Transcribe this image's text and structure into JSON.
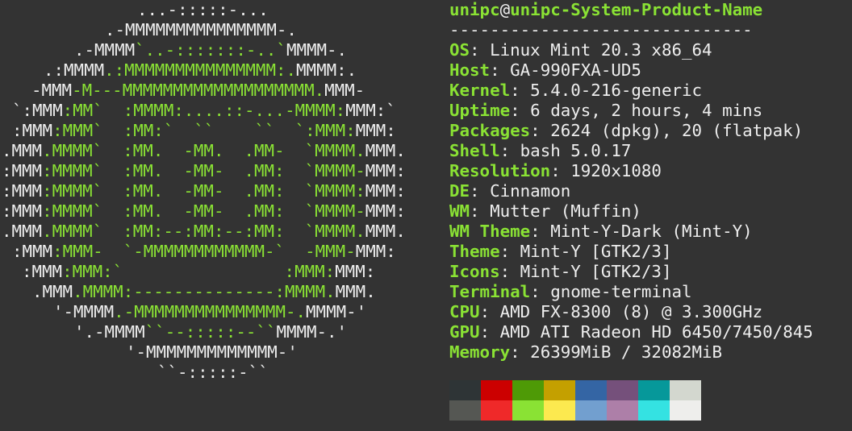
{
  "logo": {
    "lines": [
      [
        {
          "t": "...-:::::-...",
          "c": "w"
        }
      ],
      [
        {
          "t": ".-MMMMMMMMMMMMMMM-.",
          "c": "w"
        }
      ],
      [
        {
          "t": ".-MMMM",
          "c": "w"
        },
        {
          "t": "`..-:::::::-..`",
          "c": "g"
        },
        {
          "t": "MMMM-.",
          "c": "w"
        }
      ],
      [
        {
          "t": ".:MMMM",
          "c": "w"
        },
        {
          "t": ".:MMMMMMMMMMMMMMM:.",
          "c": "g"
        },
        {
          "t": "MMMM:.",
          "c": "w"
        }
      ],
      [
        {
          "t": "-MMM",
          "c": "w"
        },
        {
          "t": "-M---MMMMMMMMMMMMMMMMMMM.",
          "c": "g"
        },
        {
          "t": "MMM-",
          "c": "w"
        }
      ],
      [
        {
          "t": "`:MMM",
          "c": "w"
        },
        {
          "t": ":MM`  :MMMM:....::-...-MMMM:",
          "c": "g"
        },
        {
          "t": "MMM:`",
          "c": "w"
        }
      ],
      [
        {
          "t": ":MMM",
          "c": "w"
        },
        {
          "t": ":MMM`  :MM:`  ``    ``  `:MMM:",
          "c": "g"
        },
        {
          "t": "MMM:",
          "c": "w"
        }
      ],
      [
        {
          "t": ".MMM",
          "c": "w"
        },
        {
          "t": ".MMMM`  :MM.  -MM.  .MM-  `MMMM.",
          "c": "g"
        },
        {
          "t": "MMM.",
          "c": "w"
        }
      ],
      [
        {
          "t": ":MMM",
          "c": "w"
        },
        {
          "t": ":MMMM`  :MM.  -MM-  .MM:  `MMMM-",
          "c": "g"
        },
        {
          "t": "MMM:",
          "c": "w"
        }
      ],
      [
        {
          "t": ":MMM",
          "c": "w"
        },
        {
          "t": ":MMMM`  :MM.  -MM-  .MM:  `MMMM:",
          "c": "g"
        },
        {
          "t": "MMM:",
          "c": "w"
        }
      ],
      [
        {
          "t": ":MMM",
          "c": "w"
        },
        {
          "t": ":MMMM`  :MM.  -MM-  .MM:  `MMMM-",
          "c": "g"
        },
        {
          "t": "MMM:",
          "c": "w"
        }
      ],
      [
        {
          "t": ".MMM",
          "c": "w"
        },
        {
          "t": ".MMMM`  :MM:--:MM:--:MM:  `MMMM.",
          "c": "g"
        },
        {
          "t": "MMM.",
          "c": "w"
        }
      ],
      [
        {
          "t": ":MMM",
          "c": "w"
        },
        {
          "t": ":MMM-  `-MMMMMMMMMMMM-`  -MMM-",
          "c": "g"
        },
        {
          "t": "MMM:",
          "c": "w"
        }
      ],
      [
        {
          "t": ":MMM",
          "c": "w"
        },
        {
          "t": ":MMM:`                :MMM:",
          "c": "g"
        },
        {
          "t": "MMM:",
          "c": "w"
        }
      ],
      [
        {
          "t": ".MMM",
          "c": "w"
        },
        {
          "t": ".MMMM:--------------:MMMM.",
          "c": "g"
        },
        {
          "t": "MMM.",
          "c": "w"
        }
      ],
      [
        {
          "t": "'-MMMM",
          "c": "w"
        },
        {
          "t": ".-MMMMMMMMMMMMMMM-.",
          "c": "g"
        },
        {
          "t": "MMMM-'",
          "c": "w"
        }
      ],
      [
        {
          "t": "'.-MMMM",
          "c": "w"
        },
        {
          "t": "``--:::::--``",
          "c": "g"
        },
        {
          "t": "MMMM-.'",
          "c": "w"
        }
      ],
      [
        {
          "t": "'-MMMMMMMMMMMMM-'",
          "c": "w"
        }
      ],
      [
        {
          "t": "``-:::::-``",
          "c": "w"
        }
      ]
    ]
  },
  "info": {
    "user": "unipc",
    "at": "@",
    "host": "unipc-System-Product-Name",
    "separator": "------------------------------",
    "rows": [
      {
        "key": "OS",
        "value": "Linux Mint 20.3 x86_64"
      },
      {
        "key": "Host",
        "value": "GA-990FXA-UD5"
      },
      {
        "key": "Kernel",
        "value": "5.4.0-216-generic"
      },
      {
        "key": "Uptime",
        "value": "6 days, 2 hours, 4 mins"
      },
      {
        "key": "Packages",
        "value": "2624 (dpkg), 20 (flatpak)"
      },
      {
        "key": "Shell",
        "value": "bash 5.0.17"
      },
      {
        "key": "Resolution",
        "value": "1920x1080"
      },
      {
        "key": "DE",
        "value": "Cinnamon"
      },
      {
        "key": "WM",
        "value": "Mutter (Muffin)"
      },
      {
        "key": "WM Theme",
        "value": "Mint-Y-Dark (Mint-Y)"
      },
      {
        "key": "Theme",
        "value": "Mint-Y [GTK2/3]"
      },
      {
        "key": "Icons",
        "value": "Mint-Y [GTK2/3]"
      },
      {
        "key": "Terminal",
        "value": "gnome-terminal"
      },
      {
        "key": "CPU",
        "value": "AMD FX-8300 (8) @ 3.300GHz"
      },
      {
        "key": "GPU",
        "value": "AMD ATI Radeon HD 6450/7450/845"
      },
      {
        "key": "Memory",
        "value": "26399MiB / 32082MiB"
      }
    ]
  },
  "palette": {
    "normal": [
      "#2e3436",
      "#cc0000",
      "#4e9a06",
      "#c4a000",
      "#3465a4",
      "#75507b",
      "#06989a",
      "#d3d7cf"
    ],
    "bright": [
      "#555753",
      "#ef2929",
      "#8ae234",
      "#fce94f",
      "#729fcf",
      "#ad7fa8",
      "#34e2e2",
      "#eeeeec"
    ]
  }
}
